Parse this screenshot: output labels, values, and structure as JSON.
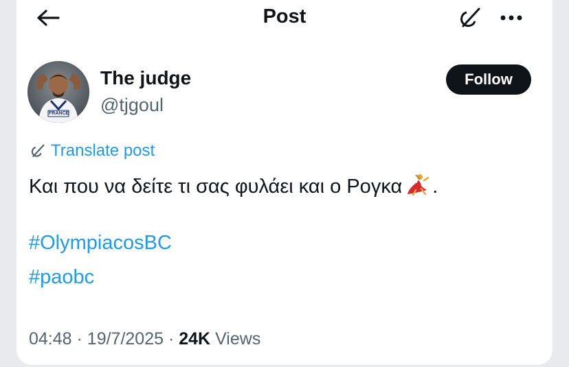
{
  "header": {
    "title": "Post",
    "back_icon": "arrow-left-icon",
    "grok_icon": "grok-icon",
    "more_icon": "more-horizontal-icon"
  },
  "author": {
    "display_name": "The judge",
    "handle": "@tjgoul",
    "avatar_jersey_text": "FRANCE"
  },
  "follow_button": {
    "label": "Follow"
  },
  "translate": {
    "label": "Translate post",
    "icon": "grok-icon"
  },
  "post": {
    "text": "Και που να δείτε τι σας φυλάει και ο Ρογκα",
    "emoji": "woman-dancing-emoji",
    "trailing": ".",
    "hashtags": [
      "#OlympiacosBC",
      "#paobc"
    ]
  },
  "meta": {
    "time": "04:48",
    "separator": "·",
    "date": "19/7/2025",
    "views_count": "24K",
    "views_label": "Views"
  },
  "colors": {
    "link": "#1d9bf0",
    "text": "#0f1419",
    "secondary": "#536471",
    "button_bg": "#0f1419"
  }
}
